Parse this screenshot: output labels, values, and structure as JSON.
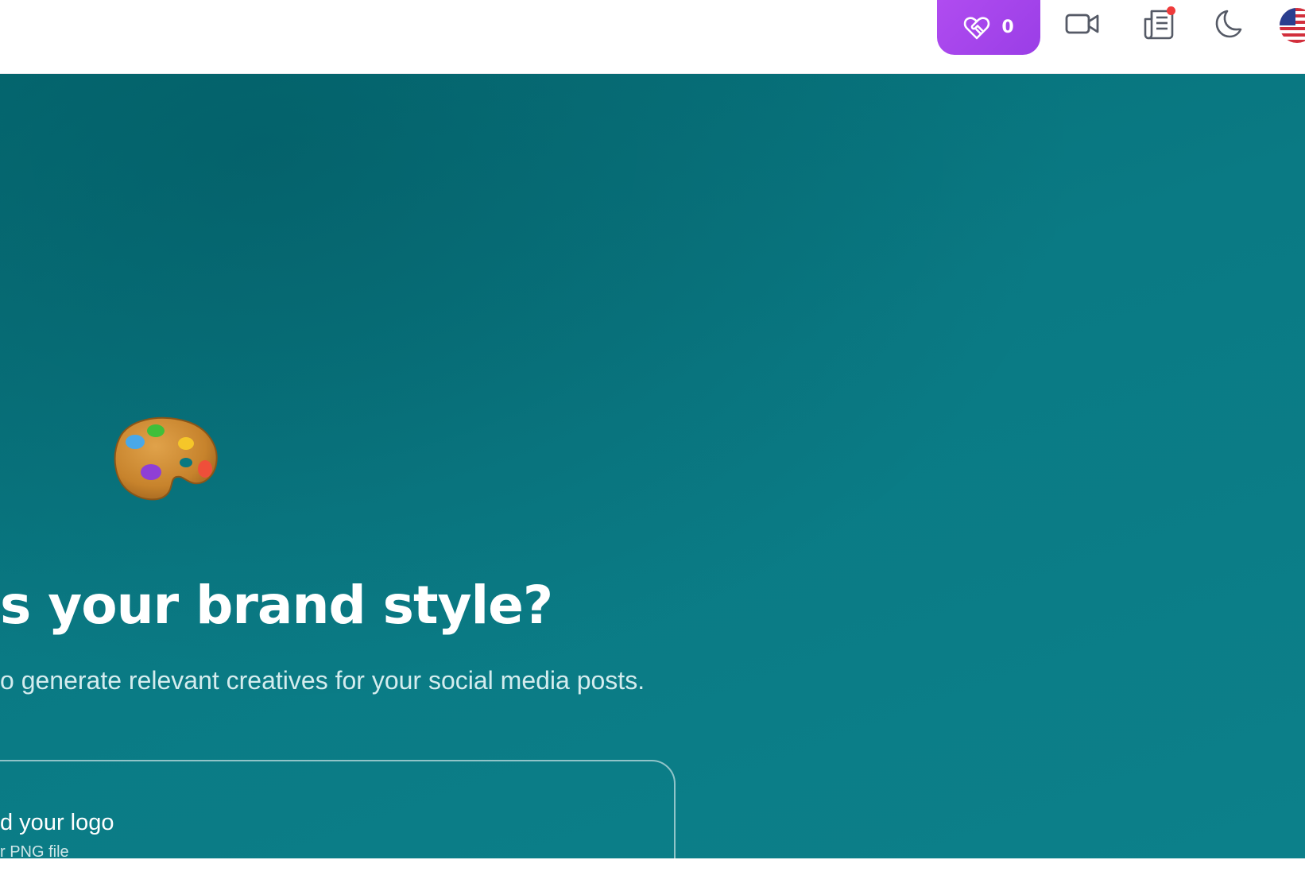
{
  "header": {
    "credits": {
      "count": "0",
      "icon": "heart-handshake-icon",
      "color": "#a046ec"
    },
    "icons": {
      "video": "video-camera-icon",
      "news": "newspaper-icon",
      "theme": "moon-icon",
      "language": "us-flag-icon"
    },
    "notification_dot_color": "#ef3b3b"
  },
  "hero": {
    "background_color": "#0a7a84",
    "emoji": "artist-palette-icon",
    "heading": "s your brand style?",
    "subheading": "o generate relevant creatives for your social media posts.",
    "upload": {
      "title": "d your logo",
      "hint": "r PNG file"
    }
  }
}
